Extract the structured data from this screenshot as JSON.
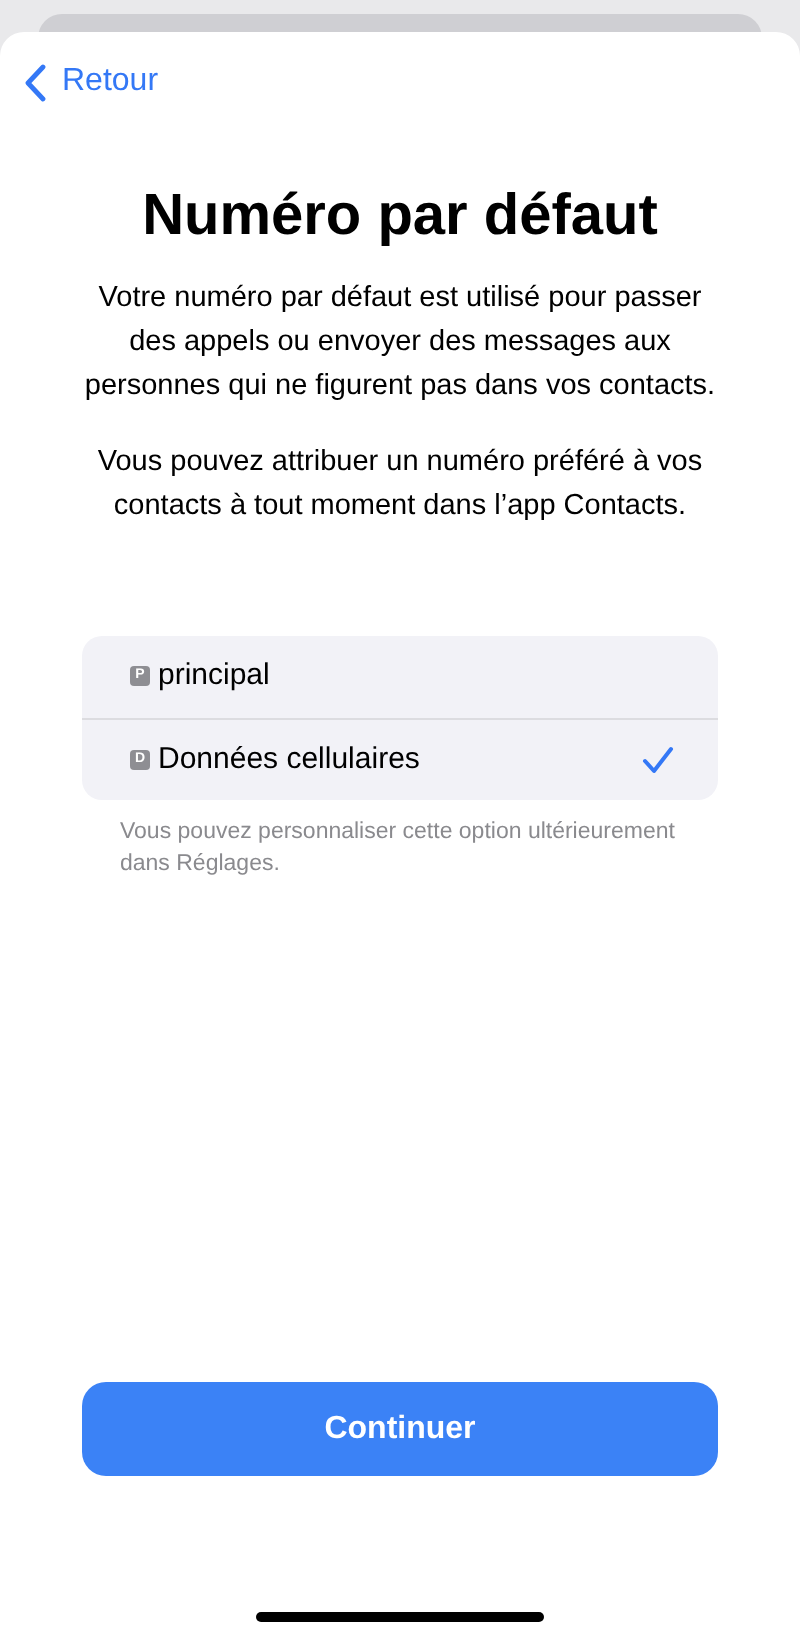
{
  "nav": {
    "back": "Retour"
  },
  "title": "Numéro par défaut",
  "paragraphs": [
    "Votre numéro par défaut est utilisé pour passer des appels ou envoyer des messages aux personnes qui ne figurent pas dans vos contacts.",
    "Vous pouvez attribuer un numéro préféré à vos contacts à tout moment dans l’app Contacts."
  ],
  "options": [
    {
      "badge": "P",
      "label": "principal",
      "selected": false
    },
    {
      "badge": "D",
      "label": "Données cellulaires",
      "selected": true
    }
  ],
  "footnote": "Vous pouvez personnaliser cette option ultérieurement dans Réglages.",
  "button": "Continuer"
}
